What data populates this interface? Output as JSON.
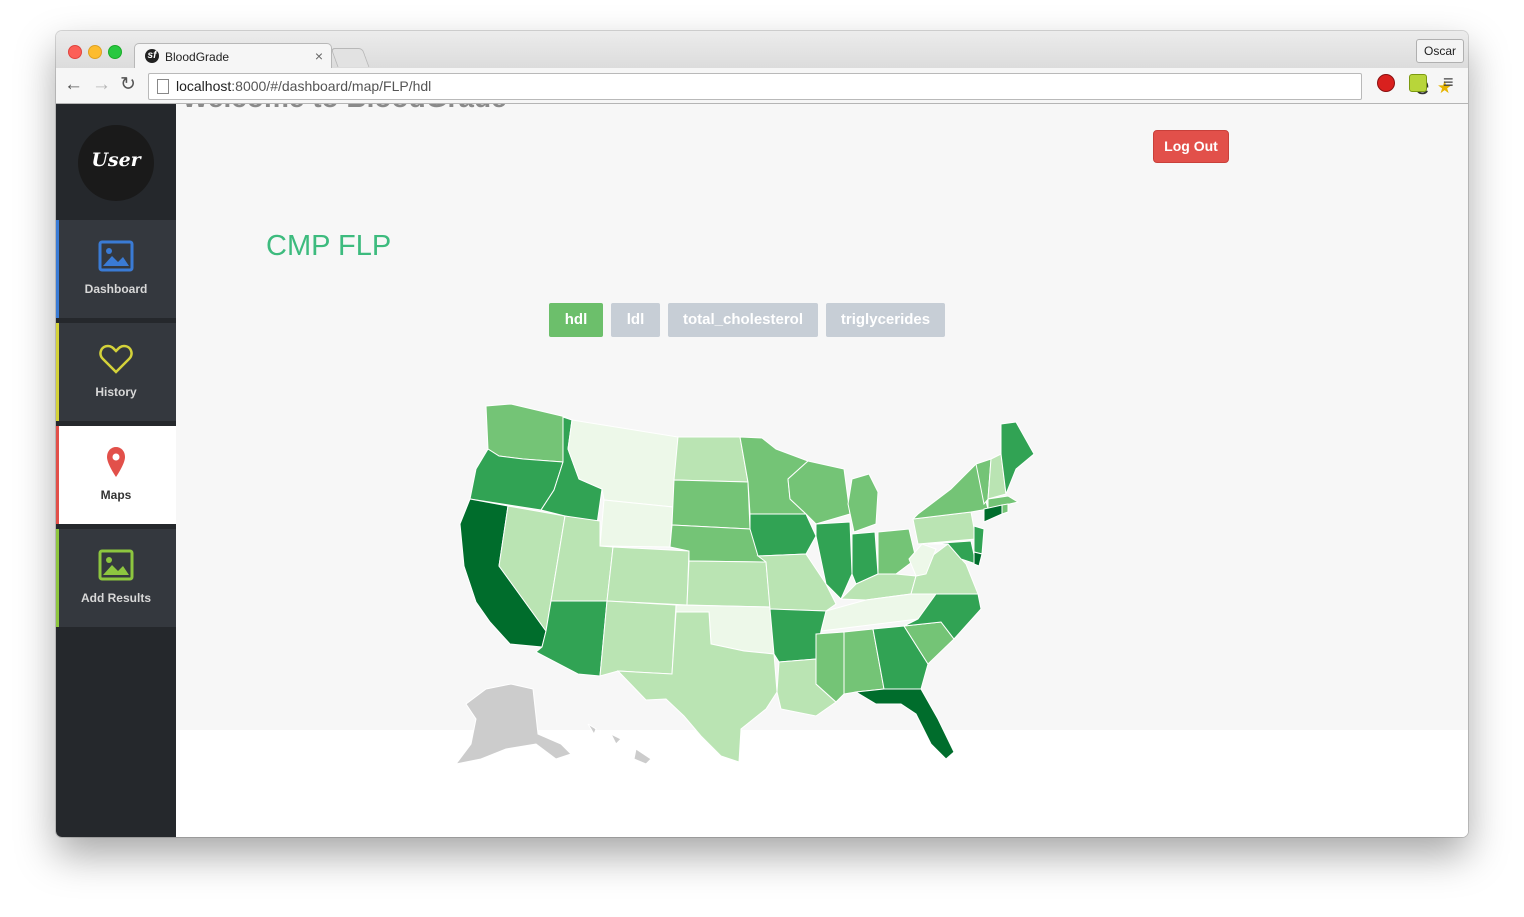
{
  "browser": {
    "tab_title": "BloodGrade",
    "tab_favicon": "symfony-icon",
    "profile_name": "Oscar",
    "url_host": "localhost",
    "url_rest": ":8000/#/dashboard/map/FLP/hdl"
  },
  "sidebar": {
    "avatar_text": "User",
    "items": [
      {
        "label": "Dashboard",
        "icon": "image-icon",
        "accent": "#3a7bd5"
      },
      {
        "label": "History",
        "icon": "heart-icon",
        "accent": "#d4d23a"
      },
      {
        "label": "Maps",
        "icon": "map-pin-icon",
        "accent": "#e2504a"
      },
      {
        "label": "Add Results",
        "icon": "image-icon",
        "accent": "#8dc63f"
      }
    ]
  },
  "main": {
    "welcome": "Welcome to BloodGrade",
    "logout_label": "Log Out",
    "title": "CMP FLP",
    "metric_buttons": [
      "hdl",
      "ldl",
      "total_cholesterol",
      "triglycerides"
    ],
    "active_metric": "hdl"
  },
  "map": {
    "type": "choropleth",
    "colors": {
      "1": "#edf8e9",
      "2": "#bae4b3",
      "3": "#74c476",
      "4": "#31a354",
      "5": "#006d2c",
      "na": "#cccccc"
    }
  }
}
